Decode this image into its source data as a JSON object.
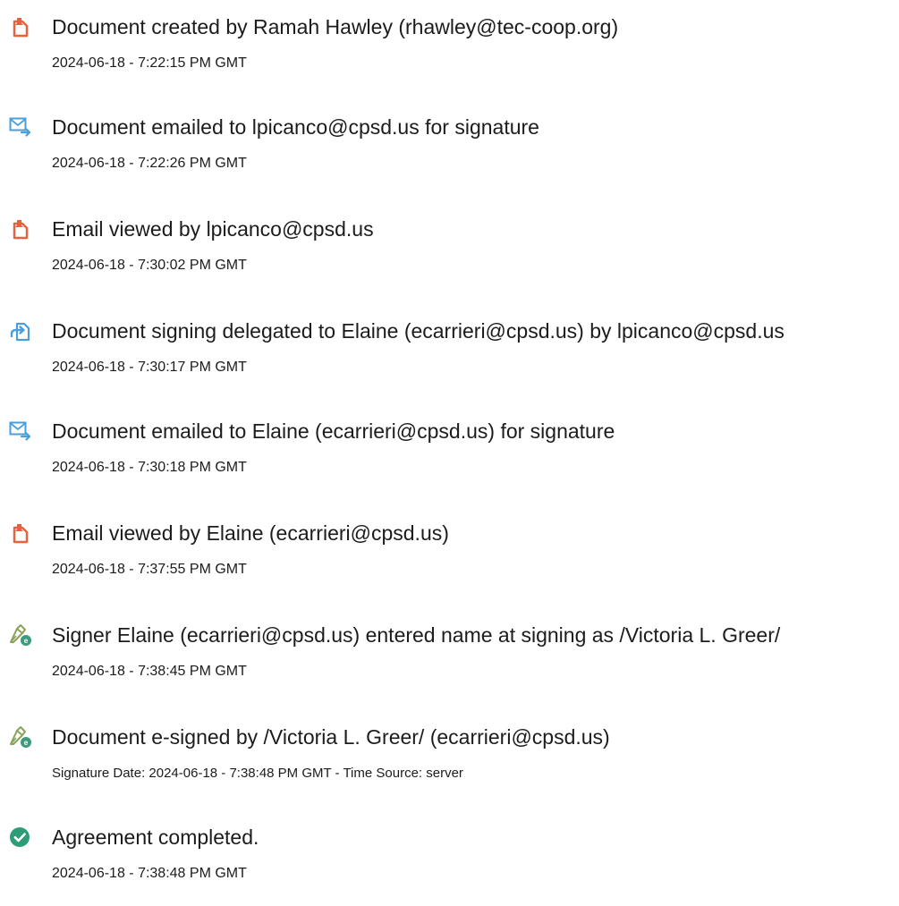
{
  "colors": {
    "doc_icon": "#e8603c",
    "email_icon": "#4a9fd8",
    "delegate_icon": "#4a9fd8",
    "sign_icon": "#8aa35a",
    "complete_icon": "#2d9d78"
  },
  "events": [
    {
      "icon": "document-icon",
      "title": "Document created by Ramah Hawley (rhawley@tec-coop.org)",
      "detail": "2024-06-18 - 7:22:15 PM GMT"
    },
    {
      "icon": "email-icon",
      "title": "Document emailed to lpicanco@cpsd.us for signature",
      "detail": "2024-06-18 - 7:22:26 PM GMT"
    },
    {
      "icon": "document-icon",
      "title": "Email viewed by lpicanco@cpsd.us",
      "detail": "2024-06-18 - 7:30:02 PM GMT"
    },
    {
      "icon": "delegate-icon",
      "title": "Document signing delegated to Elaine (ecarrieri@cpsd.us) by lpicanco@cpsd.us",
      "detail": "2024-06-18 - 7:30:17 PM GMT"
    },
    {
      "icon": "email-icon",
      "title": "Document emailed to Elaine (ecarrieri@cpsd.us) for signature",
      "detail": "2024-06-18 - 7:30:18 PM GMT"
    },
    {
      "icon": "document-icon",
      "title": "Email viewed by Elaine (ecarrieri@cpsd.us)",
      "detail": "2024-06-18 - 7:37:55 PM GMT"
    },
    {
      "icon": "sign-icon",
      "title": "Signer Elaine (ecarrieri@cpsd.us) entered name at signing as /Victoria L. Greer/",
      "detail": "2024-06-18 - 7:38:45 PM GMT"
    },
    {
      "icon": "sign-icon",
      "title": "Document e-signed by /Victoria L. Greer/ (ecarrieri@cpsd.us)",
      "detail": "Signature Date: 2024-06-18 - 7:38:48 PM GMT - Time Source: server"
    },
    {
      "icon": "checkmark-circle-icon",
      "title": "Agreement completed.",
      "detail": "2024-06-18 - 7:38:48 PM GMT"
    }
  ]
}
